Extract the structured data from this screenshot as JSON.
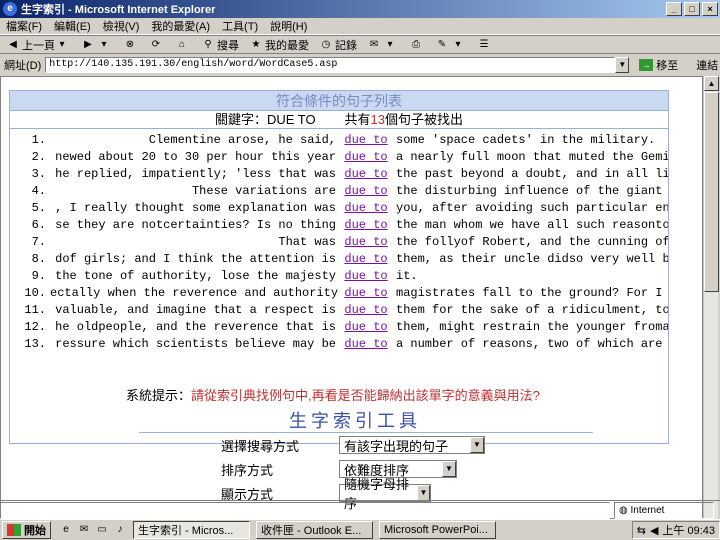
{
  "window": {
    "title": "生字索引 - Microsoft Internet Explorer",
    "minimize": "_",
    "maximize": "□",
    "close": "×"
  },
  "menu": [
    "檔案(F)",
    "編輯(E)",
    "檢視(V)",
    "我的最愛(A)",
    "工具(T)",
    "說明(H)"
  ],
  "toolbar": {
    "back": "上一頁",
    "stop": "停止",
    "refresh": "重新整理",
    "home": "首頁",
    "search": "搜尋",
    "favorites": "我的最愛",
    "history": "記錄"
  },
  "address": {
    "label": "網址(D)",
    "url": "http://140.135.191.30/english/word/WordCase5.asp",
    "go": "移至",
    "links": "連結"
  },
  "results": {
    "title": "符合條件的句子列表",
    "keyword_label": "關鍵字：DUE TO",
    "count_prefix": "共有",
    "count": "13",
    "count_suffix": "個句子被找出",
    "keyword": "due to",
    "rows": [
      {
        "n": "1.",
        "left": "Clementine arose, he said,",
        "right": "some 'space cadets' in the military."
      },
      {
        "n": "2.",
        "left": "newed about 20 to 30 per hour this year",
        "right": "a nearly full moon that muted the Gemin"
      },
      {
        "n": "3.",
        "left": "he replied, impatiently; 'less that was",
        "right": "the past beyond a doubt, and in all lik"
      },
      {
        "n": "4.",
        "left": "These variations are",
        "right": "the disturbing influence of the giant p"
      },
      {
        "n": "5.",
        "left": ", I really thought some explanation was",
        "right": "you, after avoiding such particular end"
      },
      {
        "n": "6.",
        "left": "se they are notcertainties? Is no thing",
        "right": "the man whom we have all such reasonto"
      },
      {
        "n": "7.",
        "left": "That was",
        "right": "the follyof Robert, and the cunning of"
      },
      {
        "n": "8.",
        "left": "dof girls; and I think the attention is",
        "right": "them, as their uncle didso very well by"
      },
      {
        "n": "9.",
        "left": "the tone of authority, lose the majesty",
        "right": "it."
      },
      {
        "n": "10.",
        "left": "ectally when the reverence and authority",
        "right": "magistrates fall to the ground? For I c"
      },
      {
        "n": "11.",
        "left": "valuable, and imagine that a respect is",
        "right": "them for the sake of a ridiculment, to"
      },
      {
        "n": "12.",
        "left": "he oldpeople, and the reverence that is",
        "right": "them, might restrain the younger fromal"
      },
      {
        "n": "13.",
        "left": "ressure which scientists believe may be",
        "right": "a number of reasons, two of which are t"
      }
    ]
  },
  "hint": {
    "label": "系統提示：",
    "text": "請從索引典找例句中,再看是否能歸納出該單字的意義與用法?"
  },
  "tool_title": "生字索引工具",
  "form": {
    "search_mode_label": "選擇搜尋方式",
    "search_mode_value": "有該字出現的句子",
    "sort_label": "排序方式",
    "sort_value": "依難度排序",
    "third_label": "顯示方式",
    "third_value": "隨機字母排序"
  },
  "status": {
    "zone": "Internet"
  },
  "taskbar": {
    "start": "開始",
    "tasks": [
      "生字索引 - Micros...",
      "收件匣 - Outlook E...",
      "Microsoft PowerPoi..."
    ],
    "clock": "上午 09:43"
  }
}
